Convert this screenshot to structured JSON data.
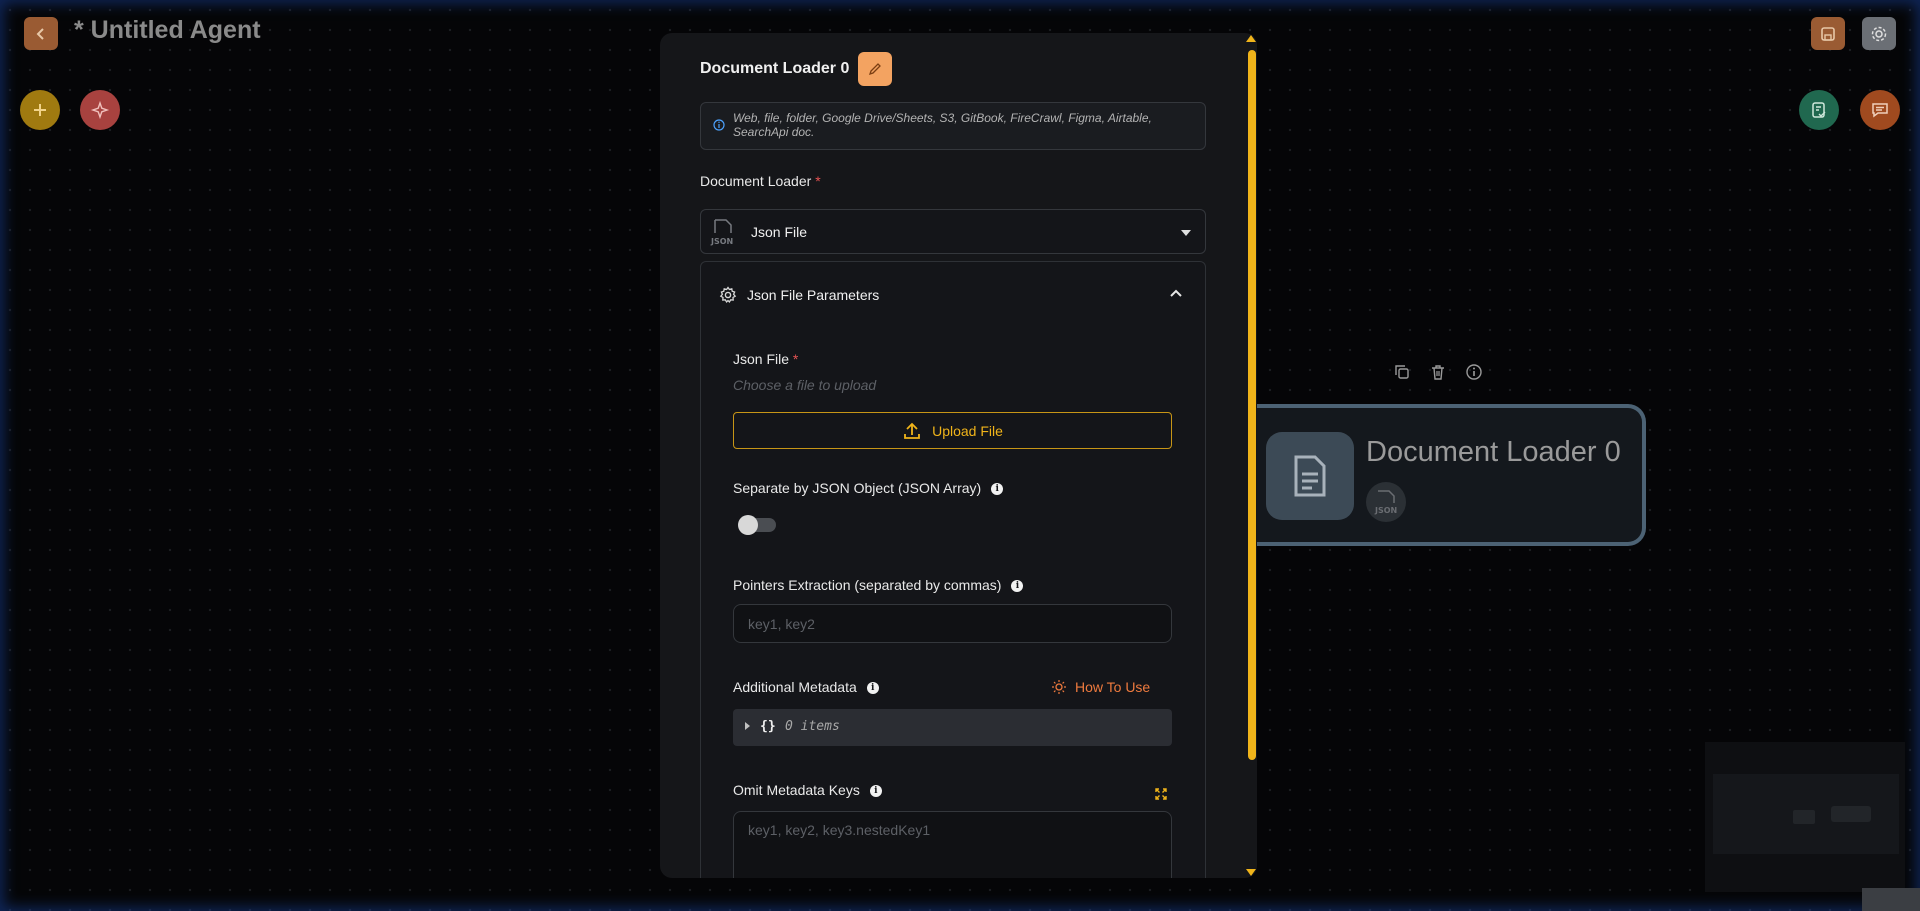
{
  "header": {
    "title": "* Untitled Agent"
  },
  "node": {
    "title": "Document Loader 0"
  },
  "panel": {
    "title": "Document Loader 0",
    "info_text": "Web, file, folder, Google Drive/Sheets, S3, GitBook, FireCrawl, Figma, Airtable, SearchApi doc.",
    "document_loader_label": "Document Loader",
    "required_mark": "*",
    "selected_loader": "Json File",
    "params_title": "Json File Parameters",
    "json_file_label": "Json File",
    "json_file_placeholder": "Choose a file to upload",
    "upload_label": "Upload File",
    "separate_label": "Separate by JSON Object (JSON Array)",
    "separate_enabled": false,
    "pointers_label": "Pointers Extraction (separated by commas)",
    "pointers_placeholder": "key1, key2",
    "metadata_label": "Additional Metadata",
    "how_to_use": "How To Use",
    "metadata_brace": "{}",
    "metadata_count": "0 items",
    "omit_label": "Omit Metadata Keys",
    "omit_placeholder": "key1, key2, key3.nestedKey1",
    "info_glyph": "i"
  },
  "colors": {
    "accent": "#f0b41a",
    "orange": "#ee7a3e",
    "edit_button": "#f3a361",
    "required": "#e55353"
  }
}
